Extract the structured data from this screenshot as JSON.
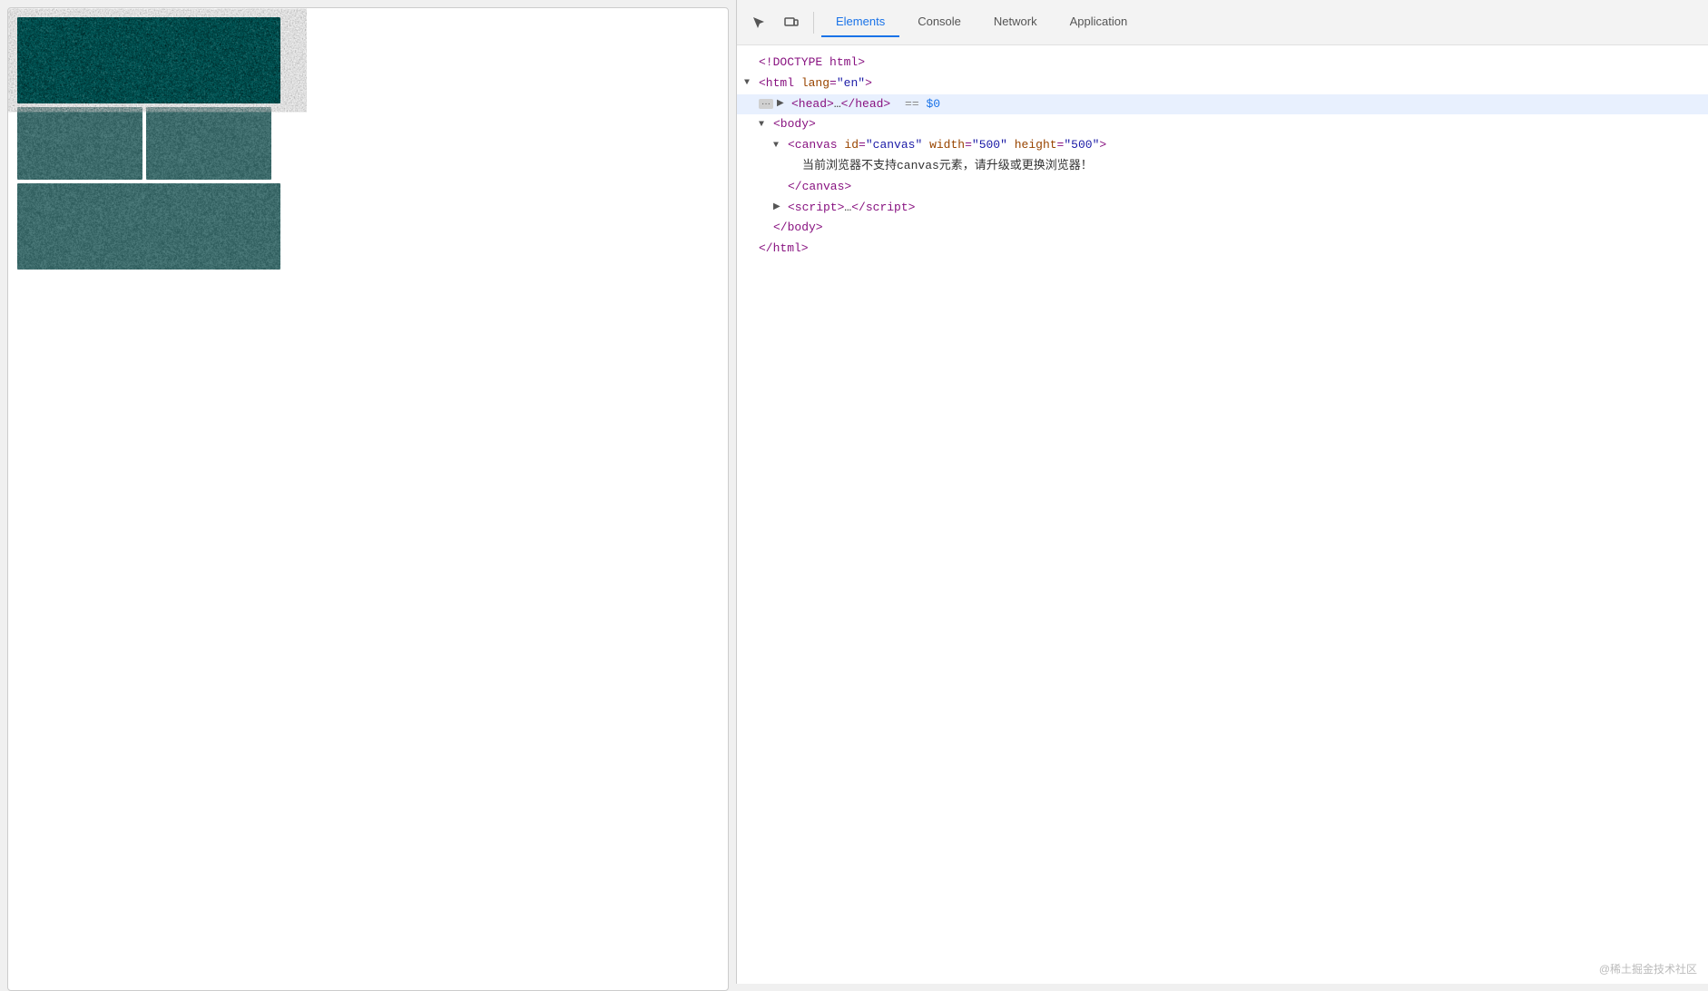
{
  "browser": {
    "canvas_fallback_text": "当前浏览器不支持canvas元素，请升级或更换浏览器！"
  },
  "devtools": {
    "tabs": [
      {
        "id": "elements",
        "label": "Elements",
        "active": true
      },
      {
        "id": "console",
        "label": "Console",
        "active": false
      },
      {
        "id": "network",
        "label": "Network",
        "active": false
      },
      {
        "id": "application",
        "label": "Application",
        "active": false
      }
    ],
    "dom": {
      "doctype": "<!DOCTYPE html>",
      "html_open": "<html lang=\"en\">",
      "head_collapsed": "<head>…</head>",
      "head_selected_marker": "== $0",
      "body_open": "<body>",
      "canvas_open": "<canvas id=\"canvas\" width=\"500\" height=\"500\">",
      "canvas_fallback": "当前浏览器不支持canvas元素，请升级或更换浏览器！",
      "canvas_close": "</canvas>",
      "script_collapsed": "<script>…</script>",
      "body_close": "</body>",
      "html_close": "</html>"
    }
  },
  "watermark": "@稀土掘金技术社区",
  "icons": {
    "cursor": "⬡",
    "device": "▭"
  }
}
